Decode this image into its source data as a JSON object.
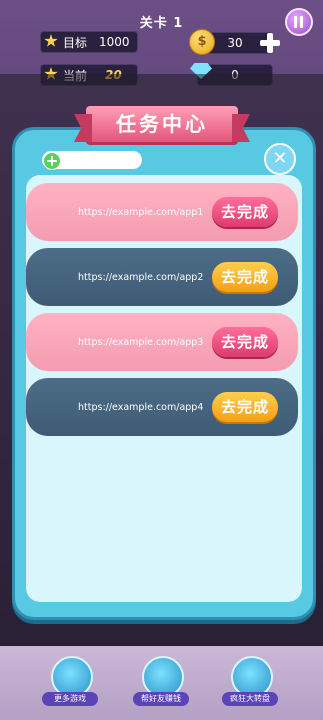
{
  "hud": {
    "level_label": "关卡  1",
    "target_label": "目标",
    "target_value": "1000",
    "current_label": "当前",
    "current_value": "20",
    "coins": "30",
    "gems": "0"
  },
  "modal": {
    "title": "任务中心",
    "tasks": [
      {
        "url": "https://example.com/app1",
        "button": "去完成",
        "style": "pink"
      },
      {
        "url": "https://example.com/app2",
        "button": "去完成",
        "style": "dark"
      },
      {
        "url": "https://example.com/app3",
        "button": "去完成",
        "style": "pink"
      },
      {
        "url": "https://example.com/app4",
        "button": "去完成",
        "style": "dark"
      }
    ]
  },
  "bottom_nav": [
    {
      "label": "更多游戏"
    },
    {
      "label": "帮好友赚钱"
    },
    {
      "label": "疯狂大转盘"
    }
  ],
  "colors": {
    "pink_button": "#de3a6e",
    "orange_button": "#f5a012",
    "panel": "#58c9e3"
  }
}
